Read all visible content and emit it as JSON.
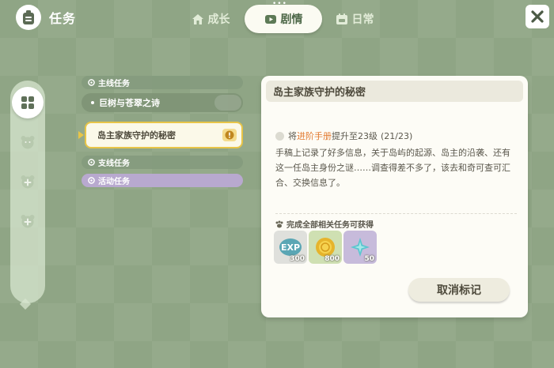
{
  "header": {
    "title": "任务",
    "tabs": [
      {
        "label": "成长",
        "icon": "house-icon"
      },
      {
        "label": "剧情",
        "icon": "film-icon"
      },
      {
        "label": "日常",
        "icon": "calendar-icon"
      }
    ],
    "active_tab": "剧情",
    "close_icon": "close-icon"
  },
  "rail": {
    "items": [
      "grid-icon",
      "bear-face-icon",
      "plus-badge-icon",
      "plus-badge-icon"
    ]
  },
  "quest_list": {
    "categories": {
      "main": "主线任务",
      "side": "支线任务",
      "event": "活动任务"
    },
    "main_quests": [
      "巨树与苍翠之诗",
      "岛主家族守护的秘密"
    ],
    "selected_index": 1
  },
  "detail": {
    "title": "岛主家族守护的秘密",
    "objective": {
      "prefix": "将",
      "link": "进阶手册",
      "suffix": "提升至23级",
      "progress": "(21/23)"
    },
    "description": "手稿上记录了好多信息，关于岛屿的起源、岛主的沿袭、还有这一任岛主身份之谜……调查得差不多了，该去和奇可查可汇合、交换信息了。",
    "rewards_title": "完成全部相关任务可获得",
    "rewards": [
      {
        "type": "exp",
        "label": "EXP",
        "amount": "300"
      },
      {
        "type": "coin",
        "amount": "800"
      },
      {
        "type": "star",
        "amount": "50"
      }
    ],
    "cancel_label": "取消标记"
  },
  "colors": {
    "background": "#8fa585",
    "highlight": "#e8c548",
    "objective_link": "#e2792f",
    "event_category": "#b8a9cf"
  }
}
